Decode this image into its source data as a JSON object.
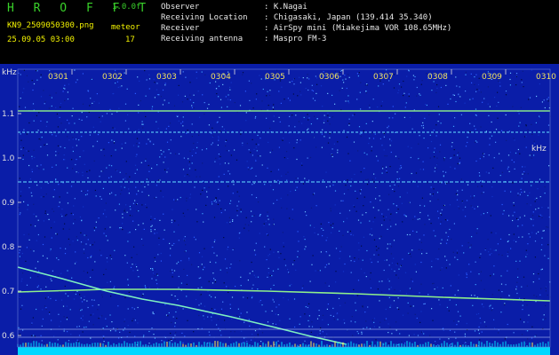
{
  "header": {
    "app_title": "H R O F F T",
    "version": "1.0.0f",
    "filename": "KN9_2509050300.png",
    "mode_label": "meteor",
    "count": "17",
    "timestamp": "25.09.05 03:00"
  },
  "info": {
    "observer_label": "Observer",
    "observer_value": ": K.Nagai",
    "location_label": "Receiving Location",
    "location_value": ": Chigasaki, Japan (139.414 35.340)",
    "receiver_label": "Receiver",
    "receiver_value": ": AirSpy mini (Miakejima VOR 108.65MHz)",
    "antenna_label": "Receiving antenna",
    "antenna_value": ": Maspro FM-3"
  },
  "axis": {
    "y_unit_top": "kHz",
    "y_unit_bottom": "kHz",
    "y_ticks": [
      "1.1",
      "1.0",
      "0.9",
      "0.8",
      "0.7",
      "0.6"
    ],
    "x_ticks": [
      "0301",
      "0302",
      "0303",
      "0304",
      "0305",
      "0306",
      "0307",
      "0308",
      "0309",
      "0310"
    ]
  },
  "colors": {
    "background": "#0a1da8",
    "noise_light": "#3fa0ff",
    "noise_dark": "#000a40",
    "line_signal": "#7ef0c0",
    "baseline": "#00e6ff"
  }
}
